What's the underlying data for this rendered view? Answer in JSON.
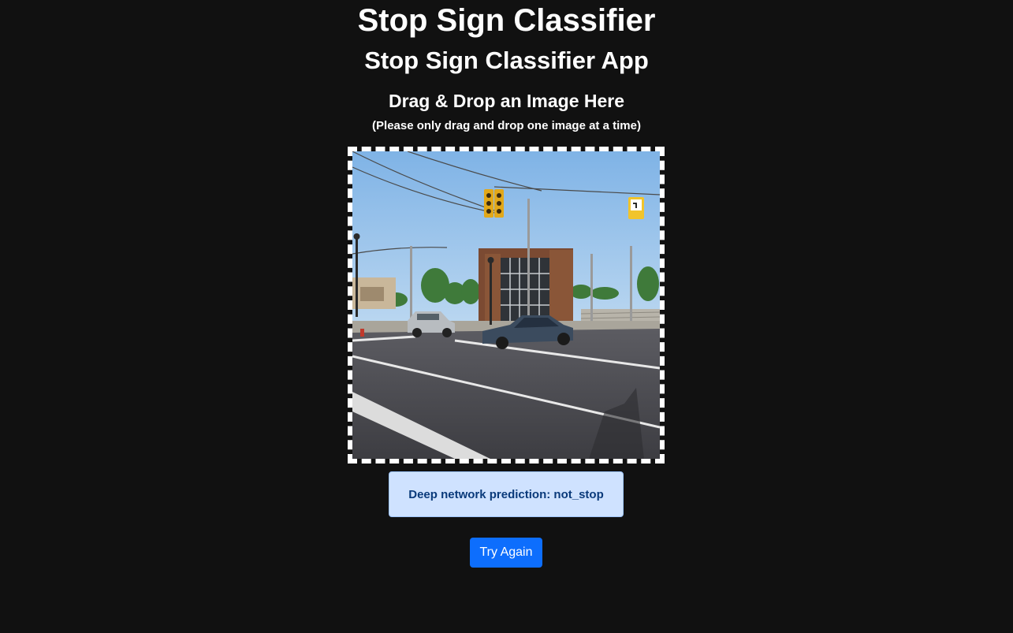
{
  "header": {
    "title": "Stop Sign Classifier",
    "subtitle": "Stop Sign Classifier App"
  },
  "dropzone": {
    "heading": "Drag & Drop an Image Here",
    "note": "(Please only drag and drop one image at a time)"
  },
  "result": {
    "prediction_text": "Deep network prediction: not_stop"
  },
  "actions": {
    "try_again_label": "Try Again"
  },
  "colors": {
    "background": "#111111",
    "alert_bg": "#cfe2ff",
    "alert_text": "#0a3a7a",
    "button_bg": "#0d6efd"
  }
}
